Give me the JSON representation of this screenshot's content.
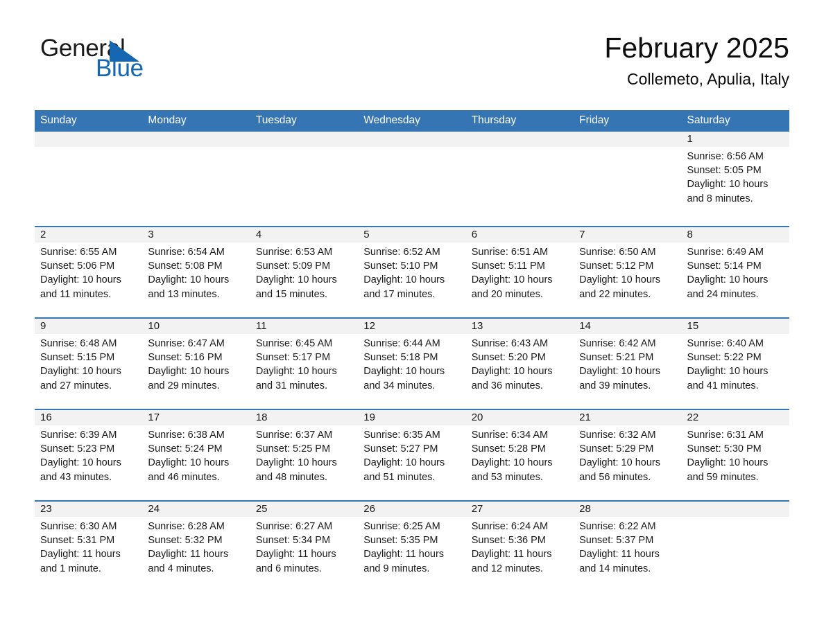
{
  "brand": {
    "name_part1": "General",
    "name_part2": "Blue",
    "triangle_color": "#1667b2",
    "accent_color": "#3575b4"
  },
  "header": {
    "title": "February 2025",
    "subtitle": "Collemeto, Apulia, Italy"
  },
  "columns": [
    "Sunday",
    "Monday",
    "Tuesday",
    "Wednesday",
    "Thursday",
    "Friday",
    "Saturday"
  ],
  "labels": {
    "sunrise": "Sunrise:",
    "sunset": "Sunset:",
    "daylight": "Daylight:"
  },
  "weeks": [
    [
      {
        "day": ""
      },
      {
        "day": ""
      },
      {
        "day": ""
      },
      {
        "day": ""
      },
      {
        "day": ""
      },
      {
        "day": ""
      },
      {
        "day": "1",
        "sunrise": "Sunrise: 6:56 AM",
        "sunset": "Sunset: 5:05 PM",
        "daylight": "Daylight: 10 hours and 8 minutes."
      }
    ],
    [
      {
        "day": "2",
        "sunrise": "Sunrise: 6:55 AM",
        "sunset": "Sunset: 5:06 PM",
        "daylight": "Daylight: 10 hours and 11 minutes."
      },
      {
        "day": "3",
        "sunrise": "Sunrise: 6:54 AM",
        "sunset": "Sunset: 5:08 PM",
        "daylight": "Daylight: 10 hours and 13 minutes."
      },
      {
        "day": "4",
        "sunrise": "Sunrise: 6:53 AM",
        "sunset": "Sunset: 5:09 PM",
        "daylight": "Daylight: 10 hours and 15 minutes."
      },
      {
        "day": "5",
        "sunrise": "Sunrise: 6:52 AM",
        "sunset": "Sunset: 5:10 PM",
        "daylight": "Daylight: 10 hours and 17 minutes."
      },
      {
        "day": "6",
        "sunrise": "Sunrise: 6:51 AM",
        "sunset": "Sunset: 5:11 PM",
        "daylight": "Daylight: 10 hours and 20 minutes."
      },
      {
        "day": "7",
        "sunrise": "Sunrise: 6:50 AM",
        "sunset": "Sunset: 5:12 PM",
        "daylight": "Daylight: 10 hours and 22 minutes."
      },
      {
        "day": "8",
        "sunrise": "Sunrise: 6:49 AM",
        "sunset": "Sunset: 5:14 PM",
        "daylight": "Daylight: 10 hours and 24 minutes."
      }
    ],
    [
      {
        "day": "9",
        "sunrise": "Sunrise: 6:48 AM",
        "sunset": "Sunset: 5:15 PM",
        "daylight": "Daylight: 10 hours and 27 minutes."
      },
      {
        "day": "10",
        "sunrise": "Sunrise: 6:47 AM",
        "sunset": "Sunset: 5:16 PM",
        "daylight": "Daylight: 10 hours and 29 minutes."
      },
      {
        "day": "11",
        "sunrise": "Sunrise: 6:45 AM",
        "sunset": "Sunset: 5:17 PM",
        "daylight": "Daylight: 10 hours and 31 minutes."
      },
      {
        "day": "12",
        "sunrise": "Sunrise: 6:44 AM",
        "sunset": "Sunset: 5:18 PM",
        "daylight": "Daylight: 10 hours and 34 minutes."
      },
      {
        "day": "13",
        "sunrise": "Sunrise: 6:43 AM",
        "sunset": "Sunset: 5:20 PM",
        "daylight": "Daylight: 10 hours and 36 minutes."
      },
      {
        "day": "14",
        "sunrise": "Sunrise: 6:42 AM",
        "sunset": "Sunset: 5:21 PM",
        "daylight": "Daylight: 10 hours and 39 minutes."
      },
      {
        "day": "15",
        "sunrise": "Sunrise: 6:40 AM",
        "sunset": "Sunset: 5:22 PM",
        "daylight": "Daylight: 10 hours and 41 minutes."
      }
    ],
    [
      {
        "day": "16",
        "sunrise": "Sunrise: 6:39 AM",
        "sunset": "Sunset: 5:23 PM",
        "daylight": "Daylight: 10 hours and 43 minutes."
      },
      {
        "day": "17",
        "sunrise": "Sunrise: 6:38 AM",
        "sunset": "Sunset: 5:24 PM",
        "daylight": "Daylight: 10 hours and 46 minutes."
      },
      {
        "day": "18",
        "sunrise": "Sunrise: 6:37 AM",
        "sunset": "Sunset: 5:25 PM",
        "daylight": "Daylight: 10 hours and 48 minutes."
      },
      {
        "day": "19",
        "sunrise": "Sunrise: 6:35 AM",
        "sunset": "Sunset: 5:27 PM",
        "daylight": "Daylight: 10 hours and 51 minutes."
      },
      {
        "day": "20",
        "sunrise": "Sunrise: 6:34 AM",
        "sunset": "Sunset: 5:28 PM",
        "daylight": "Daylight: 10 hours and 53 minutes."
      },
      {
        "day": "21",
        "sunrise": "Sunrise: 6:32 AM",
        "sunset": "Sunset: 5:29 PM",
        "daylight": "Daylight: 10 hours and 56 minutes."
      },
      {
        "day": "22",
        "sunrise": "Sunrise: 6:31 AM",
        "sunset": "Sunset: 5:30 PM",
        "daylight": "Daylight: 10 hours and 59 minutes."
      }
    ],
    [
      {
        "day": "23",
        "sunrise": "Sunrise: 6:30 AM",
        "sunset": "Sunset: 5:31 PM",
        "daylight": "Daylight: 11 hours and 1 minute."
      },
      {
        "day": "24",
        "sunrise": "Sunrise: 6:28 AM",
        "sunset": "Sunset: 5:32 PM",
        "daylight": "Daylight: 11 hours and 4 minutes."
      },
      {
        "day": "25",
        "sunrise": "Sunrise: 6:27 AM",
        "sunset": "Sunset: 5:34 PM",
        "daylight": "Daylight: 11 hours and 6 minutes."
      },
      {
        "day": "26",
        "sunrise": "Sunrise: 6:25 AM",
        "sunset": "Sunset: 5:35 PM",
        "daylight": "Daylight: 11 hours and 9 minutes."
      },
      {
        "day": "27",
        "sunrise": "Sunrise: 6:24 AM",
        "sunset": "Sunset: 5:36 PM",
        "daylight": "Daylight: 11 hours and 12 minutes."
      },
      {
        "day": "28",
        "sunrise": "Sunrise: 6:22 AM",
        "sunset": "Sunset: 5:37 PM",
        "daylight": "Daylight: 11 hours and 14 minutes."
      },
      {
        "day": ""
      }
    ]
  ]
}
